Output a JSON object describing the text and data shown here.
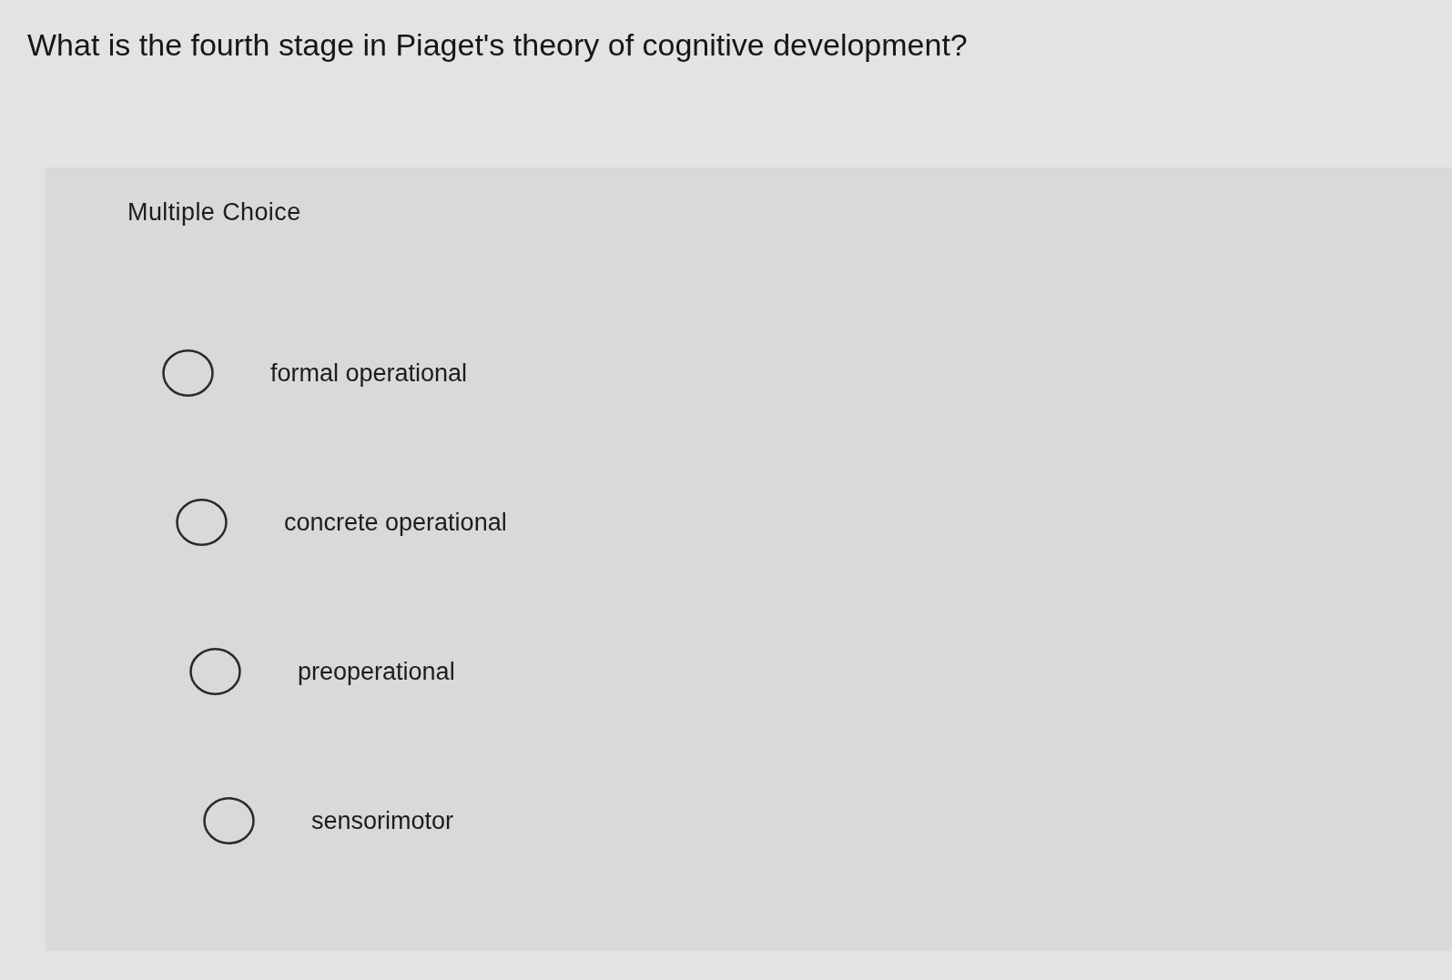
{
  "question": "What is the fourth stage in Piaget's theory of cognitive development?",
  "panel": {
    "heading": "Multiple Choice",
    "options": [
      {
        "label": "formal operational",
        "selected": false
      },
      {
        "label": "concrete operational",
        "selected": false
      },
      {
        "label": "preoperational",
        "selected": false
      },
      {
        "label": "sensorimotor",
        "selected": false
      }
    ]
  }
}
